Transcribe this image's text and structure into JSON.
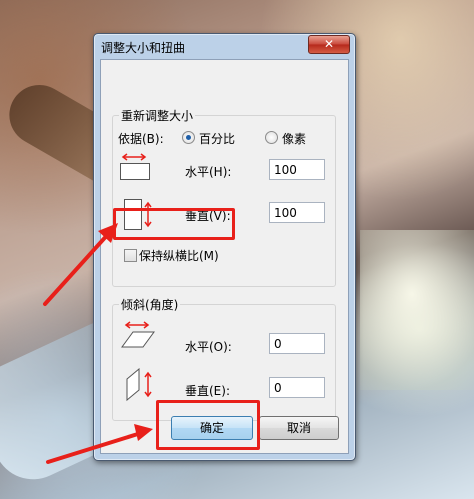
{
  "dialog": {
    "title": "调整大小和扭曲",
    "close_label": "✕"
  },
  "resize": {
    "group_label": "重新调整大小",
    "by_label": "依据(B):",
    "option_percent": "百分比",
    "option_pixels": "像素",
    "selected": "percent",
    "horizontal_label": "水平(H):",
    "horizontal_value": "100",
    "vertical_label": "垂直(V):",
    "vertical_value": "100",
    "keep_aspect_label": "保持纵横比(M)",
    "keep_aspect_checked": false
  },
  "skew": {
    "group_label": "倾斜(角度)",
    "horizontal_label": "水平(O):",
    "horizontal_value": "0",
    "vertical_label": "垂直(E):",
    "vertical_value": "0"
  },
  "buttons": {
    "ok_label": "确定",
    "cancel_label": "取消"
  },
  "colors": {
    "highlight": "#e8201a",
    "accent": "#1f5fa8"
  },
  "icons": {
    "resize_horizontal": "resize-horizontal-icon",
    "resize_vertical": "resize-vertical-icon",
    "skew_horizontal": "skew-horizontal-icon",
    "skew_vertical": "skew-vertical-icon"
  }
}
